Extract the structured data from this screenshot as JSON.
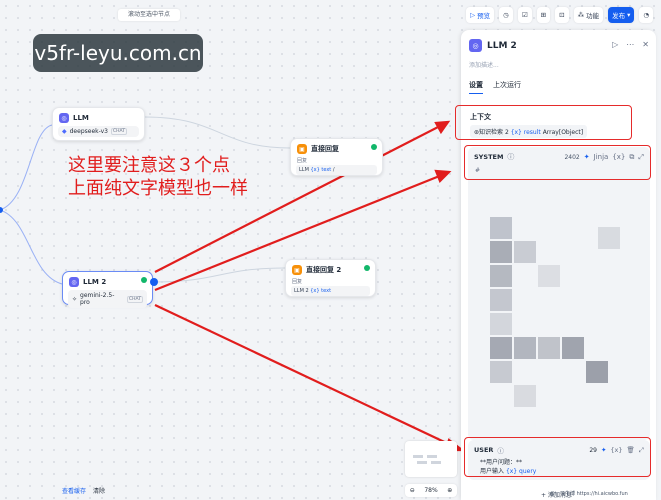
{
  "watermark": "v5fr-leyu.com.cn",
  "canvas": {
    "scroll_hint": "滚动至选中节点",
    "annotation_line1": "这里要注意这３个点",
    "annotation_line2": "上面纯文字模型也一样",
    "bottom_view_cache": "查看缓存",
    "bottom_clear": "清除",
    "zoom_level": "78%"
  },
  "toolbar": {
    "preview": "预览",
    "features": "功能",
    "publish": "发布"
  },
  "nodes": {
    "llm1": {
      "title": "LLM",
      "model": "deepseek-v3",
      "chip": "CHAT"
    },
    "llm2": {
      "title": "LLM 2",
      "model": "gemini-2.5-pro",
      "chip": "CHAT"
    },
    "answer1": {
      "title": "直接回复",
      "label": "回复",
      "var_node": "LLM",
      "var": "{x} text",
      "suffix": "/"
    },
    "answer2": {
      "title": "直接回复 2",
      "label": "回复",
      "var_node": "LLM 2",
      "var": "{x} text"
    }
  },
  "panel": {
    "title": "LLM 2",
    "desc_placeholder": "添加描述...",
    "tab_settings": "设置",
    "tab_last_run": "上次运行",
    "context_label": "上下文",
    "context_node": "知识检索 2",
    "context_var": "{x} result",
    "context_type": "Array[Object]",
    "system_label": "SYSTEM",
    "system_count": "2402",
    "system_line": "# ",
    "jinja": "Jinja",
    "user_label": "USER",
    "user_count": "29",
    "user_line1": "**用户问题：**",
    "user_input": "用户输入",
    "user_var": "{x} query",
    "add_message": "+ 添加消息"
  },
  "credit": "@一只牛博 https://hi.aicwbo.fun"
}
